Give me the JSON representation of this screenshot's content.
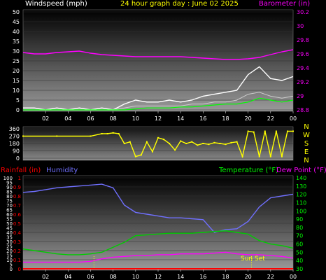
{
  "header": {
    "wind_label": "Windspeed (mph)",
    "title": "24 hour graph day : June 02 2025",
    "baro_label": "Barometer (in)"
  },
  "compass": [
    "N",
    "W",
    "S",
    "E",
    "N"
  ],
  "labels": {
    "rain": "Rainfall (in)",
    "humidity": "Humidity",
    "temperature": "Temperature (°F)",
    "dewpoint": "Dew Point (°F)",
    "sunset": "Sun Set"
  },
  "colors": {
    "wind": "#ffffff",
    "wind_avg": "#00ff00",
    "barometer": "#ff00ff",
    "direction": "#ffff00",
    "rain": "#ff0000",
    "humidity": "#7070ff",
    "temperature": "#00cc00",
    "dewpoint": "#ff00ff",
    "axis_left": "#ff0000",
    "axis_right": "#00ff00",
    "sunset": "#ffff00"
  },
  "chart_data": [
    {
      "type": "line",
      "name": "wind-barometer",
      "x_ticks": [
        "02",
        "04",
        "06",
        "08",
        "10",
        "12",
        "14",
        "16",
        "18",
        "20",
        "22",
        "00"
      ],
      "x": [
        0,
        1,
        2,
        3,
        4,
        5,
        6,
        7,
        8,
        9,
        10,
        11,
        12,
        13,
        14,
        15,
        16,
        17,
        18,
        19,
        20,
        21,
        22,
        23,
        24
      ],
      "ylim_left": [
        0,
        50
      ],
      "yticks_left": [
        "0",
        "5",
        "10",
        "15",
        "20",
        "25",
        "30",
        "35",
        "40",
        "45",
        "50"
      ],
      "ylim_right": [
        28.8,
        30.2
      ],
      "yticks_right": [
        "28.8",
        "29",
        "29.2",
        "29.4",
        "29.6",
        "29.8",
        "30",
        "30.2"
      ],
      "series": [
        {
          "axis": "left",
          "style": "gust",
          "values": [
            1,
            1,
            0,
            1,
            0,
            1,
            0,
            1,
            0,
            3,
            5,
            4,
            4,
            5,
            4,
            5,
            7,
            8,
            9,
            10,
            18,
            22,
            16,
            15,
            17
          ]
        },
        {
          "axis": "left",
          "style": "wind",
          "values": [
            0,
            0,
            0,
            0,
            0,
            0,
            0,
            0,
            0,
            1,
            2,
            2,
            2,
            2,
            2,
            3,
            3,
            4,
            4,
            5,
            8,
            9,
            7,
            6,
            7
          ]
        },
        {
          "axis": "left",
          "style": "avg",
          "values": [
            0,
            0,
            0,
            0,
            0,
            0,
            0,
            0,
            0,
            0,
            0.5,
            1,
            1,
            1,
            1.5,
            1.5,
            2,
            2.5,
            3,
            3,
            4,
            6,
            5,
            4,
            5
          ]
        },
        {
          "axis": "right",
          "style": "baro",
          "values": [
            29.62,
            29.6,
            29.6,
            29.62,
            29.63,
            29.64,
            29.61,
            29.59,
            29.58,
            29.57,
            29.56,
            29.56,
            29.56,
            29.56,
            29.56,
            29.55,
            29.54,
            29.53,
            29.52,
            29.52,
            29.53,
            29.55,
            29.59,
            29.63,
            29.66
          ]
        }
      ]
    },
    {
      "type": "scatter",
      "name": "wind-direction",
      "x_ticks": [
        "02",
        "04",
        "06",
        "08",
        "10",
        "12",
        "14",
        "16",
        "18",
        "20",
        "22",
        "00"
      ],
      "ylim": [
        0,
        360
      ],
      "yticks": [
        "0",
        "90",
        "180",
        "270",
        "360"
      ],
      "values": [
        [
          0,
          270
        ],
        [
          3,
          270
        ],
        [
          6,
          270
        ],
        [
          7,
          300
        ],
        [
          7.5,
          300
        ],
        [
          8,
          310
        ],
        [
          8.5,
          300
        ],
        [
          9,
          180
        ],
        [
          9.5,
          200
        ],
        [
          10,
          20
        ],
        [
          10.5,
          40
        ],
        [
          11,
          200
        ],
        [
          11.5,
          80
        ],
        [
          12,
          250
        ],
        [
          12.5,
          230
        ],
        [
          13,
          180
        ],
        [
          13.5,
          100
        ],
        [
          14,
          210
        ],
        [
          14.5,
          180
        ],
        [
          15,
          200
        ],
        [
          15.5,
          160
        ],
        [
          16,
          180
        ],
        [
          16.5,
          170
        ],
        [
          17,
          190
        ],
        [
          17.5,
          180
        ],
        [
          18,
          170
        ],
        [
          18.5,
          190
        ],
        [
          19,
          200
        ],
        [
          19.5,
          20
        ],
        [
          20,
          330
        ],
        [
          20.5,
          320
        ],
        [
          21,
          20
        ],
        [
          21.5,
          330
        ],
        [
          22,
          20
        ],
        [
          22.5,
          330
        ],
        [
          23,
          20
        ],
        [
          23.5,
          330
        ],
        [
          24,
          330
        ]
      ]
    },
    {
      "type": "line",
      "name": "humidity-temperature",
      "x_ticks": [
        "02",
        "04",
        "06",
        "08",
        "10",
        "12",
        "14",
        "16",
        "18",
        "20",
        "22",
        "00"
      ],
      "x": [
        0,
        1,
        2,
        3,
        4,
        5,
        6,
        7,
        8,
        9,
        10,
        11,
        12,
        13,
        14,
        15,
        16,
        17,
        18,
        19,
        20,
        21,
        22,
        23,
        24
      ],
      "ylim_humidity": [
        0,
        100
      ],
      "yticks_humidity": [
        "0",
        "5",
        "10",
        "15",
        "20",
        "25",
        "30",
        "35",
        "40",
        "45",
        "50",
        "55",
        "60",
        "65",
        "70",
        "75",
        "80",
        "85",
        "90",
        "95",
        "100"
      ],
      "ylim_rain": [
        0,
        1
      ],
      "yticks_rain": [
        "0",
        "0.1",
        "0.2",
        "0.3",
        "0.4",
        "0.5",
        "0.6",
        "0.7",
        "0.8",
        "0.9",
        "1"
      ],
      "ylim_temp": [
        30,
        140
      ],
      "yticks_temp": [
        "30",
        "40",
        "50",
        "60",
        "70",
        "80",
        "90",
        "100",
        "110",
        "120",
        "130",
        "140"
      ],
      "series": [
        {
          "axis": "humidity",
          "style": "humidity",
          "values": [
            84,
            85,
            87,
            89,
            90,
            91,
            92,
            93,
            89,
            70,
            62,
            60,
            58,
            56,
            56,
            55,
            54,
            40,
            43,
            44,
            52,
            68,
            78,
            80,
            82
          ]
        },
        {
          "axis": "temp",
          "style": "temperature",
          "values": [
            54,
            52,
            50,
            48,
            47,
            47,
            48,
            50,
            56,
            62,
            70,
            71,
            72,
            73,
            73,
            73,
            74,
            75,
            76,
            74,
            72,
            64,
            60,
            58,
            55
          ]
        },
        {
          "axis": "temp",
          "style": "dewpoint",
          "values": [
            38,
            38,
            38,
            38,
            38,
            38,
            39,
            42,
            44,
            45,
            46,
            46,
            47,
            47,
            48,
            48,
            48,
            49,
            50,
            48,
            47,
            47,
            46,
            45,
            43
          ]
        },
        {
          "axis": "rain",
          "style": "rain",
          "values": [
            0,
            0,
            0,
            0,
            0,
            0,
            0,
            0,
            0,
            0,
            0,
            0,
            0,
            0,
            0,
            0,
            0,
            0,
            0,
            0,
            0,
            0,
            0,
            0,
            0
          ]
        }
      ],
      "sunset_x": 20.3,
      "sunrise_x": 6.3
    }
  ]
}
